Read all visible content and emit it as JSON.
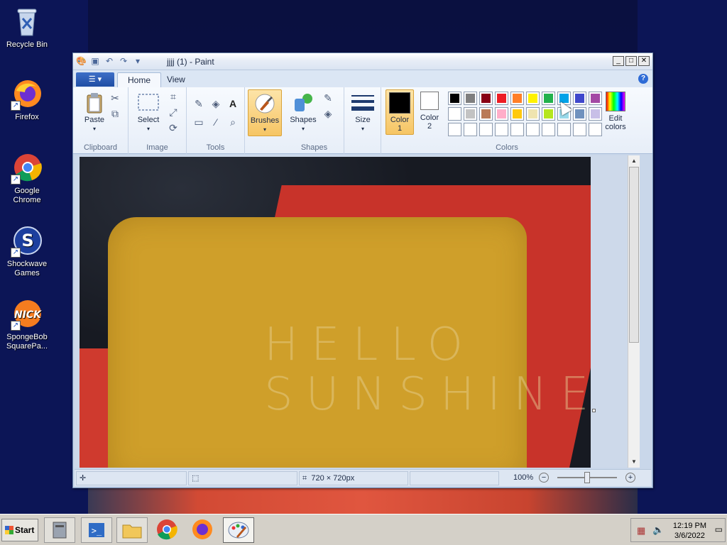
{
  "desktop": {
    "icons": [
      {
        "label": "Recycle Bin"
      },
      {
        "label": "Firefox"
      },
      {
        "label": "Google Chrome"
      },
      {
        "label": "Shockwave Games"
      },
      {
        "label": "SpongeBob SquarePa..."
      }
    ]
  },
  "window": {
    "title": "jjjj (1) - Paint",
    "tabs": [
      "Home",
      "View"
    ],
    "groups": {
      "clipboard": "Clipboard",
      "image": "Image",
      "tools": "Tools",
      "shapes": "Shapes",
      "colors": "Colors"
    },
    "buttons": {
      "paste": "Paste",
      "select": "Select",
      "brushes": "Brushes",
      "shapes": "Shapes",
      "size": "Size",
      "color1": "Color 1",
      "color2": "Color 2",
      "edit_colors": "Edit colors"
    },
    "palette_row1": [
      "#000000",
      "#7f7f7f",
      "#880015",
      "#ed1c24",
      "#ff7f27",
      "#fff200",
      "#22b14c",
      "#00a2e8",
      "#3f48cc",
      "#a349a4"
    ],
    "palette_row2": [
      "#ffffff",
      "#c3c3c3",
      "#b97a57",
      "#ffaec9",
      "#ffc90e",
      "#efe4b0",
      "#b5e61d",
      "#99d9ea",
      "#7092be",
      "#c8bfe7"
    ],
    "color1_value": "#000000",
    "color2_value": "#ffffff",
    "image_text_1": "HELLO",
    "image_text_2": "SUNSHINE",
    "status": {
      "size": "720 × 720px",
      "zoom": "100%"
    }
  },
  "taskbar": {
    "start": "Start",
    "time": "12:19 PM",
    "date": "3/6/2022"
  }
}
